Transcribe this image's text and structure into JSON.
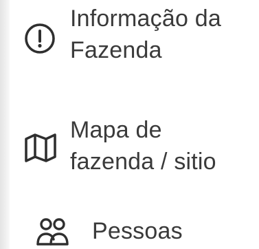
{
  "sidebar": {
    "items": [
      {
        "id": "farm-info",
        "icon": "info-circle-icon",
        "label_lines": [
          "Informação da",
          "Fazenda"
        ]
      },
      {
        "id": "farm-map",
        "icon": "map-icon",
        "label_lines": [
          "Mapa de",
          "fazenda / sitio"
        ]
      },
      {
        "id": "people",
        "icon": "users-icon",
        "label_lines": [
          "Pessoas"
        ]
      }
    ]
  },
  "colors": {
    "text": "#3a3a3a",
    "icon": "#2f2f2f",
    "sidebar_edge": "#e8e8e8",
    "background": "#ffffff"
  }
}
